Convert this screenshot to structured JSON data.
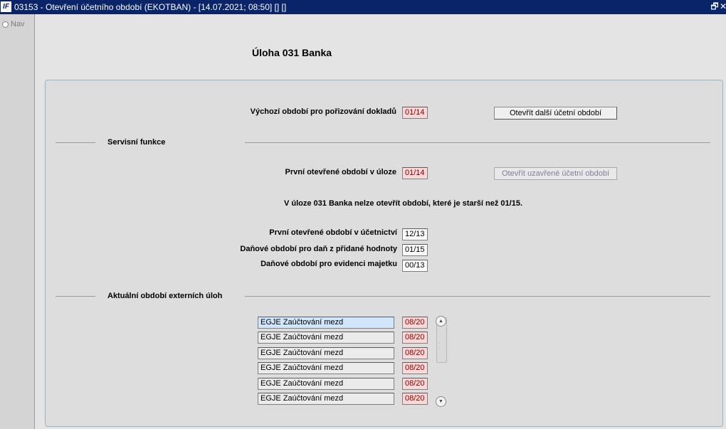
{
  "window": {
    "icon_text": "IF",
    "title": "03153 - Otevření účetního období (EKOTBAN) - [14.07.2021; 08:50] [] []",
    "restore_glyph": "🗗",
    "close_glyph": "✕"
  },
  "sidebar": {
    "nav_label": "Nav"
  },
  "page": {
    "title": "Úloha  031 Banka"
  },
  "main": {
    "default_period_label": "Výchozí období pro pořizování dokladů",
    "default_period_value": "01/14",
    "open_next_button": "Otevřít další účetní období"
  },
  "service": {
    "section_title": "Servisní funkce",
    "first_open_label": "První otevřené období v úloze",
    "first_open_value": "01/14",
    "open_closed_button": "Otevřít uzavřené účetní období",
    "note": "V úloze 031 Banka nelze otevřít období, které je starší než 01/15.",
    "accounting_label": "První otevřené období v účetnictví",
    "accounting_value": "12/13",
    "vat_label": "Daňové období pro daň z přidané hodnoty",
    "vat_value": "01/15",
    "assets_label": "Daňové období pro evidenci majetku",
    "assets_value": "00/13"
  },
  "external": {
    "section_title": "Aktuální období externích úloh",
    "rows": [
      {
        "name": "EGJE Zaúčtování mezd",
        "period": "08/20"
      },
      {
        "name": "EGJE Zaúčtování mezd",
        "period": "08/20"
      },
      {
        "name": "EGJE Zaúčtování mezd",
        "period": "08/20"
      },
      {
        "name": "EGJE Zaúčtování mezd",
        "period": "08/20"
      },
      {
        "name": "EGJE Zaúčtování mezd",
        "period": "08/20"
      },
      {
        "name": "EGJE Zaúčtování mezd",
        "period": "08/20"
      }
    ],
    "scroll_up_glyph": "▲",
    "scroll_down_glyph": "▼"
  }
}
